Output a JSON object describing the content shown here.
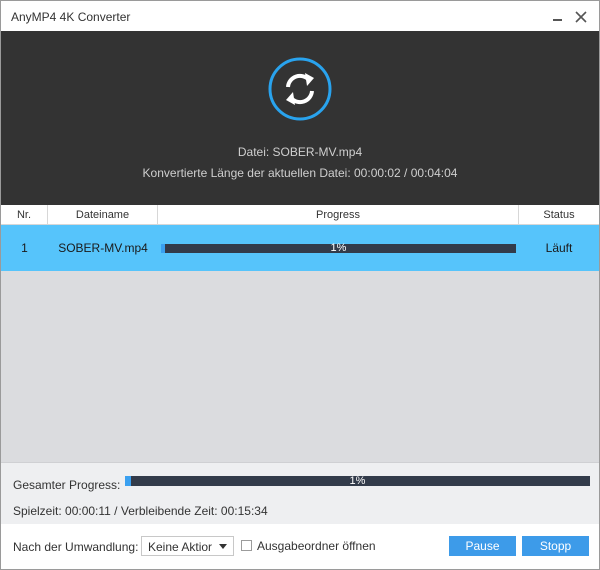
{
  "window": {
    "title": "AnyMP4 4K Converter"
  },
  "banner": {
    "file_line": "Datei: SOBER-MV.mp4",
    "length_line": "Konvertierte Länge der aktuellen Datei: 00:00:02 / 00:04:04"
  },
  "table": {
    "headers": {
      "nr": "Nr.",
      "name": "Dateiname",
      "progress": "Progress",
      "status": "Status"
    },
    "rows": [
      {
        "nr": "1",
        "name": "SOBER-MV.mp4",
        "progress": 0.01,
        "progress_label": "1%",
        "status": "Läuft"
      }
    ]
  },
  "overall": {
    "label": "Gesamter Progress:",
    "progress": 0.01,
    "progress_label": "1%",
    "time_line": "Spielzeit: 00:00:11 / Verbleibende Zeit: 00:15:34"
  },
  "footer": {
    "after_label": "Nach der Umwandlung:",
    "after_select": "Keine Aktior",
    "open_folder_label": "Ausgabeordner öffnen",
    "open_folder_checked": false,
    "pause_label": "Pause",
    "stop_label": "Stopp"
  },
  "colors": {
    "accent": "#3d9be9",
    "selected_row": "#56c4fb",
    "banner_bg": "#333333",
    "progress_track": "#323b4a"
  },
  "icons": [
    "minimize-icon",
    "close-icon",
    "convert-refresh-icon",
    "dropdown-caret-icon"
  ]
}
